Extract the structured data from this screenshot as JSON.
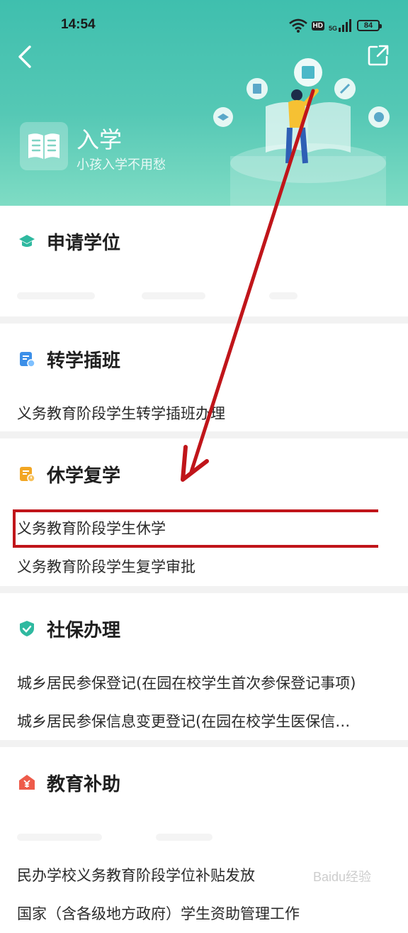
{
  "status_bar": {
    "time": "14:54",
    "hd": "HD",
    "network": "5G",
    "battery": "84"
  },
  "header": {
    "title": "入学",
    "subtitle": "小孩入学不用愁"
  },
  "sections": [
    {
      "title": "申请学位",
      "icon": "graduation-cap-icon",
      "color": "#2fb9a0",
      "items": []
    },
    {
      "title": "转学插班",
      "icon": "document-transfer-icon",
      "color": "#3c8fe8",
      "items": [
        "义务教育阶段学生转学插班办理"
      ]
    },
    {
      "title": "休学复学",
      "icon": "document-warning-icon",
      "color": "#f2a623",
      "items": [
        "义务教育阶段学生休学",
        "义务教育阶段学生复学审批"
      ]
    },
    {
      "title": "社保办理",
      "icon": "shield-check-icon",
      "color": "#2fb9a0",
      "items": [
        "城乡居民参保登记(在园在校学生首次参保登记事项)",
        "城乡居民参保信息变更登记(在园在校学生医保信…"
      ]
    },
    {
      "title": "教育补助",
      "icon": "yuan-house-icon",
      "color": "#ee5b4a",
      "items": [
        "民办学校义务教育阶段学位补贴发放",
        "国家（含各级地方政府）学生资助管理工作"
      ]
    }
  ],
  "annotation": {
    "highlight_color": "#c0151a"
  },
  "watermark": "Baidu经验"
}
